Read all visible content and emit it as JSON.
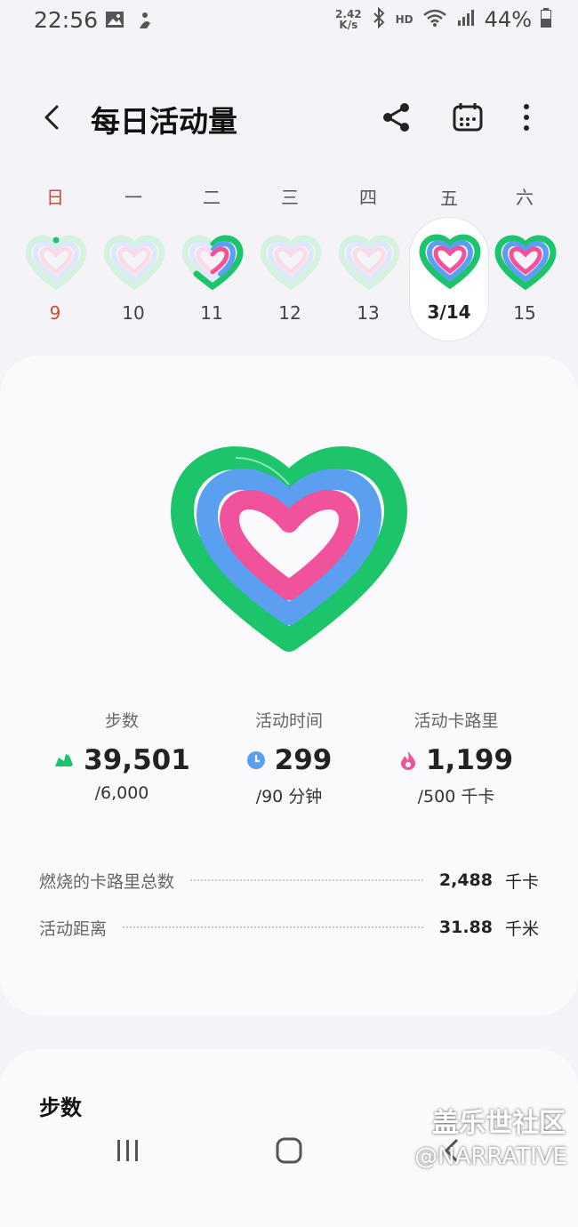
{
  "status_bar": {
    "time": "22:56",
    "net_speed": "2.42",
    "net_unit": "K/s",
    "hd": "HD",
    "battery": "44%"
  },
  "app_bar": {
    "title": "每日活动量"
  },
  "week": [
    {
      "dow": "日",
      "date": "9"
    },
    {
      "dow": "一",
      "date": "10"
    },
    {
      "dow": "二",
      "date": "11"
    },
    {
      "dow": "三",
      "date": "12"
    },
    {
      "dow": "四",
      "date": "13"
    },
    {
      "dow": "五",
      "date": "3/14"
    },
    {
      "dow": "六",
      "date": "15"
    }
  ],
  "stats": {
    "steps": {
      "label": "步数",
      "value": "39,501",
      "goal": "/6,000"
    },
    "active_time": {
      "label": "活动时间",
      "value": "299",
      "goal": "/90 分钟"
    },
    "calories": {
      "label": "活动卡路里",
      "value": "1,199",
      "goal": "/500 千卡"
    }
  },
  "rows": {
    "burned": {
      "label": "燃烧的卡路里总数",
      "value": "2,488",
      "unit": "千卡"
    },
    "distance": {
      "label": "活动距离",
      "value": "31.88",
      "unit": "千米"
    }
  },
  "section2": {
    "title": "步数"
  },
  "watermark": {
    "line1": "盖乐世社区",
    "line2": "@NARRATIVE"
  },
  "colors": {
    "green": "#1cc46a",
    "blue": "#5b9ff0",
    "pink": "#f0539c",
    "sunday": "#c94a3a"
  }
}
